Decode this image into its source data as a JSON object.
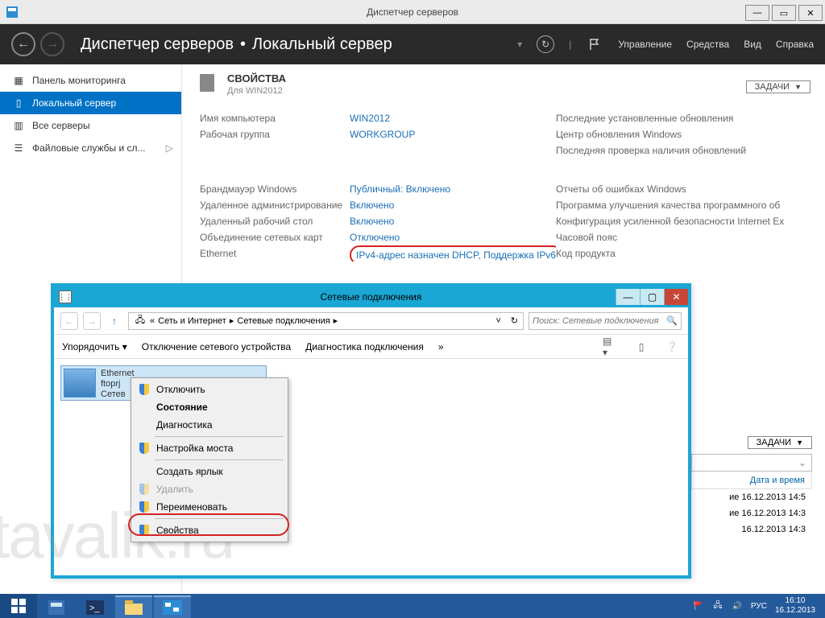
{
  "sm": {
    "title": "Диспетчер серверов",
    "breadcrumb": {
      "root": "Диспетчер серверов",
      "page": "Локальный сервер"
    },
    "menu": {
      "manage": "Управление",
      "tools": "Средства",
      "view": "Вид",
      "help": "Справка"
    },
    "sidebar": {
      "items": [
        {
          "label": "Панель мониторинга"
        },
        {
          "label": "Локальный сервер"
        },
        {
          "label": "Все серверы"
        },
        {
          "label": "Файловые службы и сл..."
        }
      ]
    },
    "props": {
      "title": "СВОЙСТВА",
      "subtitle": "Для WIN2012",
      "tasks_btn": "ЗАДАЧИ",
      "rows1": {
        "l": [
          "Имя компьютера",
          "Рабочая группа"
        ],
        "m": [
          "WIN2012",
          "WORKGROUP"
        ],
        "r": [
          "Последние установленные обновления",
          "Центр обновления Windows",
          "Последняя проверка наличия обновлений"
        ]
      },
      "rows2": {
        "l": [
          "Брандмауэр Windows",
          "Удаленное администрирование",
          "Удаленный рабочий стол",
          "Объединение сетевых карт",
          "Ethernet"
        ],
        "m": [
          "Публичный: Включено",
          "Включено",
          "Включено",
          "Отключено",
          "IPv4-адрес назначен DHCP, Поддержка IPv6"
        ],
        "r": [
          "Отчеты об ошибках Windows",
          "Программа улучшения качества программного об",
          "Конфигурация усиленной безопасности Internet Ex",
          "Часовой пояс",
          "Код продукта"
        ]
      }
    },
    "events": {
      "tasks_btn": "ЗАДАЧИ",
      "col": "Дата и время",
      "rows": [
        "ие  16.12.2013 14:5",
        "ие  16.12.2013 14:3",
        "16.12.2013 14:3"
      ]
    }
  },
  "nc": {
    "title": "Сетевые подключения",
    "path": {
      "seg1": "Сеть и Интернет",
      "seg2": "Сетевые подключения"
    },
    "search_placeholder": "Поиск: Сетевые подключения",
    "toolbar": {
      "organize": "Упорядочить",
      "disable": "Отключение сетевого устройства",
      "diag": "Диагностика подключения"
    },
    "adapter": {
      "name": "Ethernet",
      "line2": "ftoprj",
      "line3": "Сетев"
    },
    "context": {
      "disable": "Отключить",
      "status": "Состояние",
      "diag": "Диагностика",
      "bridge": "Настройка моста",
      "shortcut": "Создать ярлык",
      "delete": "Удалить",
      "rename": "Переименовать",
      "props": "Свойства"
    }
  },
  "watermark": "tavalik.ru",
  "taskbar": {
    "lang": "РУС",
    "time": "16:10",
    "date": "16.12.2013"
  }
}
